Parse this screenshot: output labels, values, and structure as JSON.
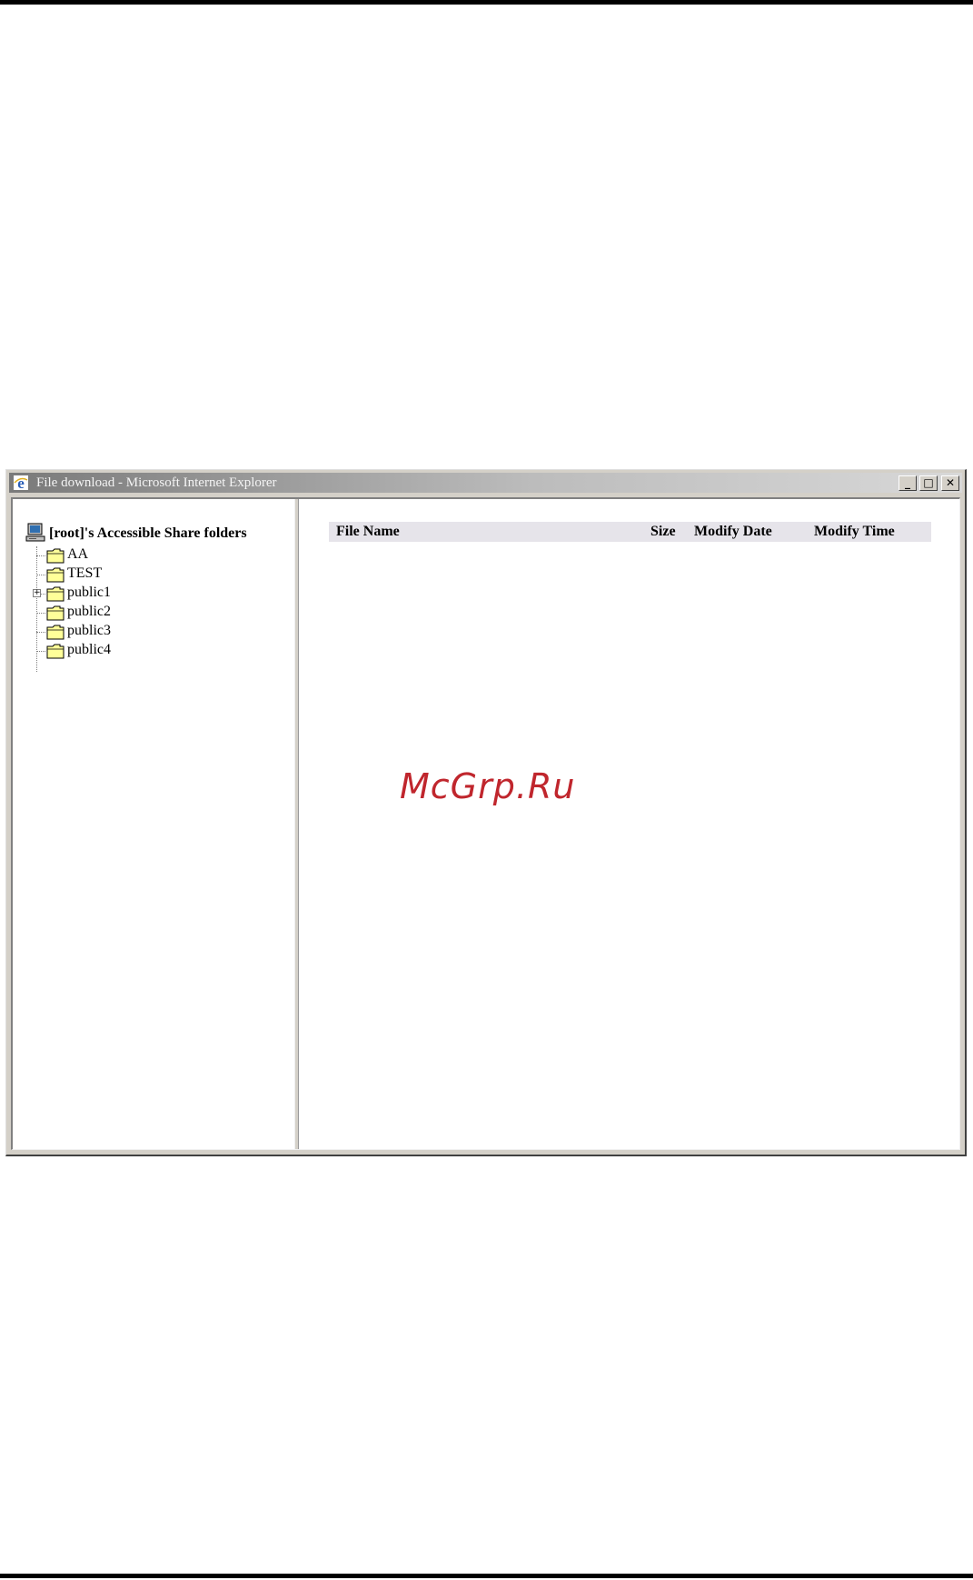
{
  "window": {
    "title": "File download - Microsoft Internet Explorer",
    "controls": {
      "minimize": "_",
      "maximize": "□",
      "close": "✕"
    },
    "icon": "ie-icon"
  },
  "tree": {
    "root_label": "[root]'s Accessible Share folders",
    "root_icon": "computer-icon",
    "items": [
      {
        "label": "AA",
        "expandable": false
      },
      {
        "label": "TEST",
        "expandable": false
      },
      {
        "label": "public1",
        "expandable": true,
        "expander": "+"
      },
      {
        "label": "public2",
        "expandable": false
      },
      {
        "label": "public3",
        "expandable": false
      },
      {
        "label": "public4",
        "expandable": false
      }
    ]
  },
  "file_list": {
    "columns": [
      "File Name",
      "Size",
      "Modify Date",
      "Modify Time"
    ],
    "rows": []
  },
  "watermark": "McGrp.Ru",
  "colors": {
    "header_bg": "#e6e4ea",
    "folder_fill": "#ffff99",
    "watermark": "#c0262d"
  }
}
